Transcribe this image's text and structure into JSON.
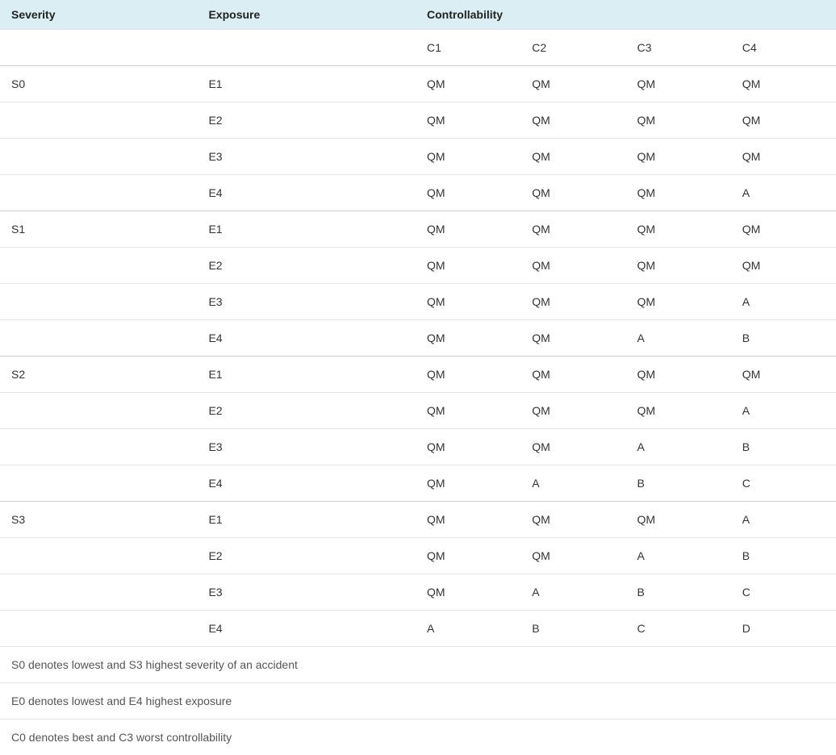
{
  "headers": {
    "severity": "Severity",
    "exposure": "Exposure",
    "controllability": "Controllability"
  },
  "controllability_cols": [
    "C1",
    "C2",
    "C3",
    "C4"
  ],
  "rows": [
    {
      "severity": "S0",
      "exposure": "E1",
      "c": [
        "QM",
        "QM",
        "QM",
        "QM"
      ]
    },
    {
      "severity": "",
      "exposure": "E2",
      "c": [
        "QM",
        "QM",
        "QM",
        "QM"
      ]
    },
    {
      "severity": "",
      "exposure": "E3",
      "c": [
        "QM",
        "QM",
        "QM",
        "QM"
      ]
    },
    {
      "severity": "",
      "exposure": "E4",
      "c": [
        "QM",
        "QM",
        "QM",
        "A"
      ]
    },
    {
      "severity": "S1",
      "exposure": "E1",
      "c": [
        "QM",
        "QM",
        "QM",
        "QM"
      ]
    },
    {
      "severity": "",
      "exposure": "E2",
      "c": [
        "QM",
        "QM",
        "QM",
        "QM"
      ]
    },
    {
      "severity": "",
      "exposure": "E3",
      "c": [
        "QM",
        "QM",
        "QM",
        "A"
      ]
    },
    {
      "severity": "",
      "exposure": "E4",
      "c": [
        "QM",
        "QM",
        "A",
        "B"
      ]
    },
    {
      "severity": "S2",
      "exposure": "E1",
      "c": [
        "QM",
        "QM",
        "QM",
        "QM"
      ]
    },
    {
      "severity": "",
      "exposure": "E2",
      "c": [
        "QM",
        "QM",
        "QM",
        "A"
      ]
    },
    {
      "severity": "",
      "exposure": "E3",
      "c": [
        "QM",
        "QM",
        "A",
        "B"
      ]
    },
    {
      "severity": "",
      "exposure": "E4",
      "c": [
        "QM",
        "A",
        "B",
        "C"
      ]
    },
    {
      "severity": "S3",
      "exposure": "E1",
      "c": [
        "QM",
        "QM",
        "QM",
        "A"
      ]
    },
    {
      "severity": "",
      "exposure": "E2",
      "c": [
        "QM",
        "QM",
        "A",
        "B"
      ]
    },
    {
      "severity": "",
      "exposure": "E3",
      "c": [
        "QM",
        "A",
        "B",
        "C"
      ]
    },
    {
      "severity": "",
      "exposure": "E4",
      "c": [
        "A",
        "B",
        "C",
        "D"
      ]
    }
  ],
  "footnotes": [
    "S0 denotes lowest and S3 highest severity of an accident",
    "E0 denotes lowest and E4 highest exposure",
    "C0 denotes best and C3 worst controllability"
  ]
}
